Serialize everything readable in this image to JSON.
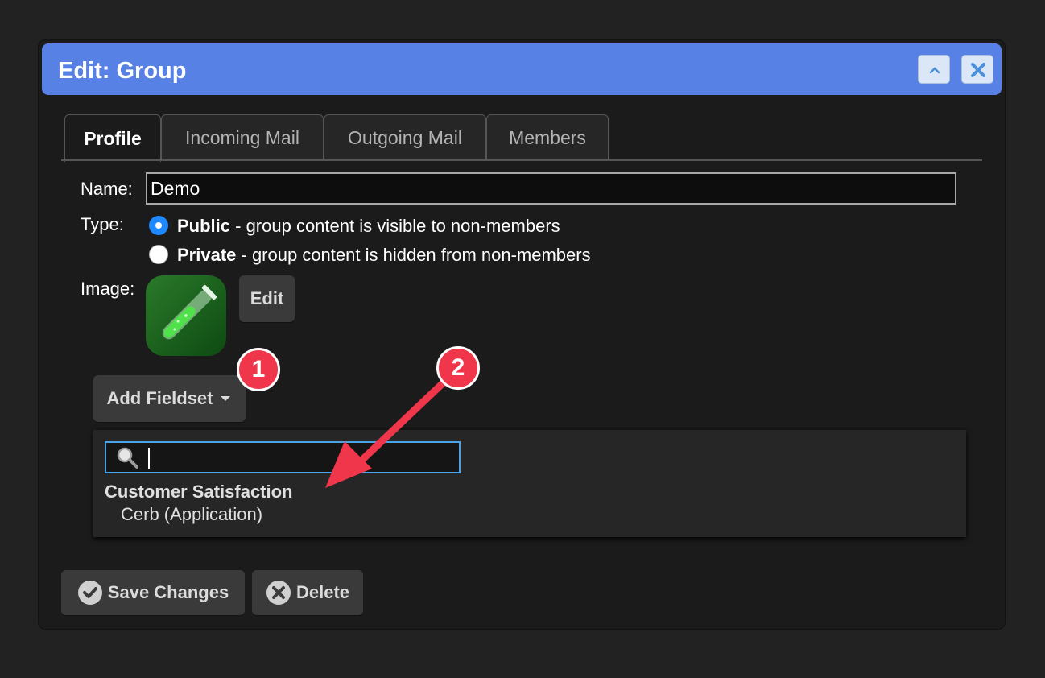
{
  "dialog": {
    "title": "Edit: Group",
    "buttons": {
      "minimize_icon": "chevron-up-icon",
      "close_icon": "close-icon"
    }
  },
  "tabs": [
    {
      "label": "Profile",
      "active": true
    },
    {
      "label": "Incoming Mail",
      "active": false
    },
    {
      "label": "Outgoing Mail",
      "active": false
    },
    {
      "label": "Members",
      "active": false
    }
  ],
  "form": {
    "name_label": "Name:",
    "name_value": "Demo",
    "type_label": "Type:",
    "type_options": [
      {
        "bold": "Public",
        "desc": " - group content is visible to non-members",
        "selected": true
      },
      {
        "bold": "Private",
        "desc": " - group content is hidden from non-members",
        "selected": false
      }
    ],
    "image_label": "Image:",
    "image_edit_label": "Edit",
    "add_fieldset_label": "Add Fieldset"
  },
  "fieldset_dropdown": {
    "search_value": "",
    "results": [
      {
        "group": "Customer Satisfaction",
        "items": [
          "Cerb (Application)"
        ]
      }
    ]
  },
  "annotations": {
    "badge_1": "1",
    "badge_2": "2",
    "color": "#f0364a"
  },
  "actions": {
    "save_label": "Save Changes",
    "delete_label": "Delete"
  }
}
